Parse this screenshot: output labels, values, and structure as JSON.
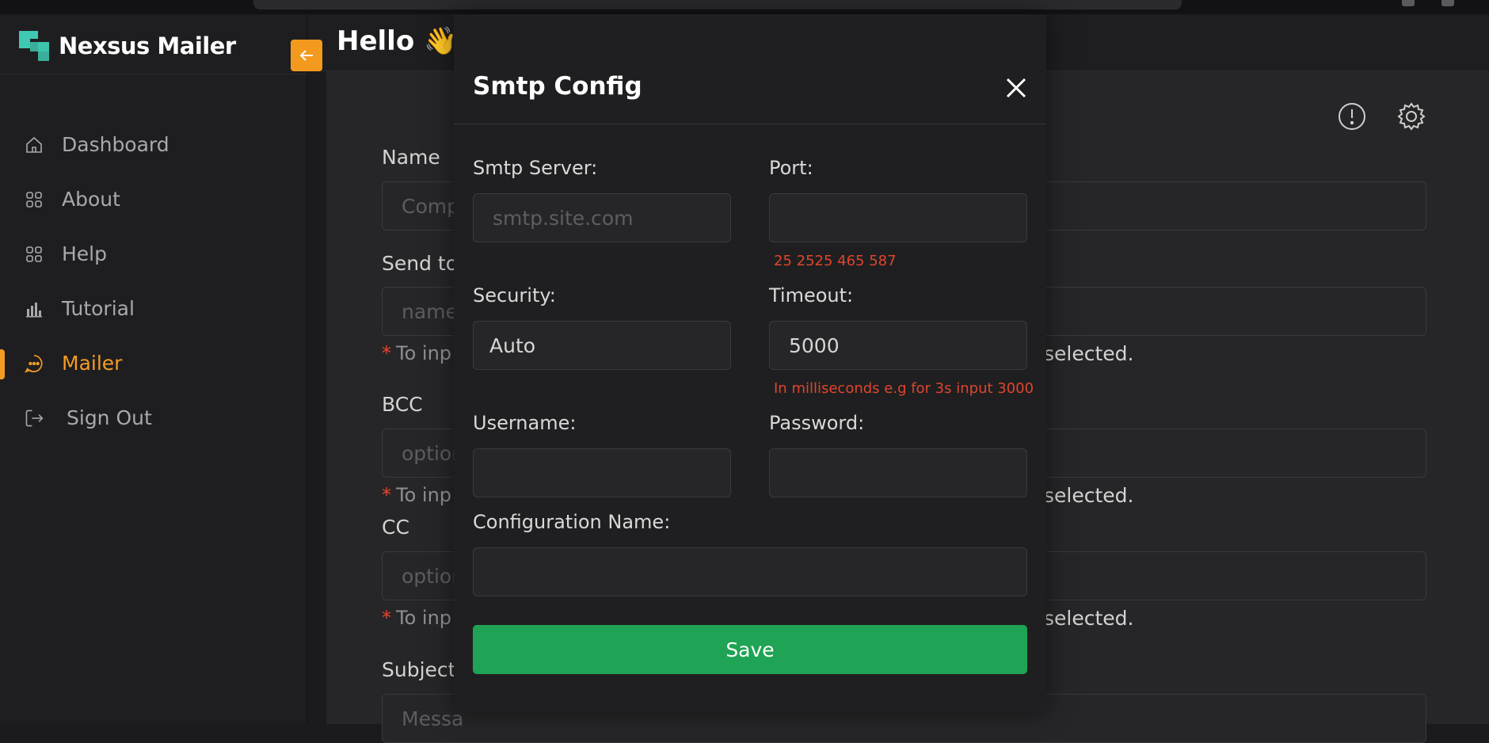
{
  "brand": {
    "name": "Nexsus Mailer"
  },
  "header": {
    "greeting": "Hello 👋"
  },
  "sidebar": {
    "items": [
      {
        "label": "Dashboard",
        "icon": "home-icon"
      },
      {
        "label": "About",
        "icon": "grid-icon"
      },
      {
        "label": "Help",
        "icon": "grid-icon"
      },
      {
        "label": "Tutorial",
        "icon": "chart-icon"
      },
      {
        "label": "Mailer",
        "icon": "chat-icon",
        "active": true
      },
      {
        "label": "Sign Out",
        "icon": "sign-out-icon"
      }
    ]
  },
  "form": {
    "name_label": "Name",
    "name_placeholder": "Comp",
    "send_to_label": "Send to",
    "send_to_placeholder": "name",
    "hint_prefix": "To inp",
    "hint_suffix": "selected.",
    "bcc_label": "BCC",
    "bcc_placeholder": "option",
    "cc_label": "CC",
    "cc_placeholder": "option",
    "subject_label": "Subject",
    "subject_placeholder": "Messa",
    "star": "*"
  },
  "modal": {
    "title": "Smtp Config",
    "smtp_server_label": "Smtp Server:",
    "smtp_server_placeholder": "smtp.site.com",
    "port_label": "Port:",
    "port_value": "",
    "port_hint": "25 2525 465 587",
    "security_label": "Security:",
    "security_value": "Auto",
    "timeout_label": "Timeout:",
    "timeout_value": "5000",
    "timeout_hint": "In milliseconds e.g for 3s input 3000",
    "username_label": "Username:",
    "username_value": "",
    "password_label": "Password:",
    "password_value": "",
    "config_name_label": "Configuration Name:",
    "config_name_value": "",
    "save_label": "Save"
  },
  "colors": {
    "accent": "#f49b23",
    "brand_logo": "#3ec9b2",
    "save": "#1fa354",
    "hint": "#e0452b"
  }
}
